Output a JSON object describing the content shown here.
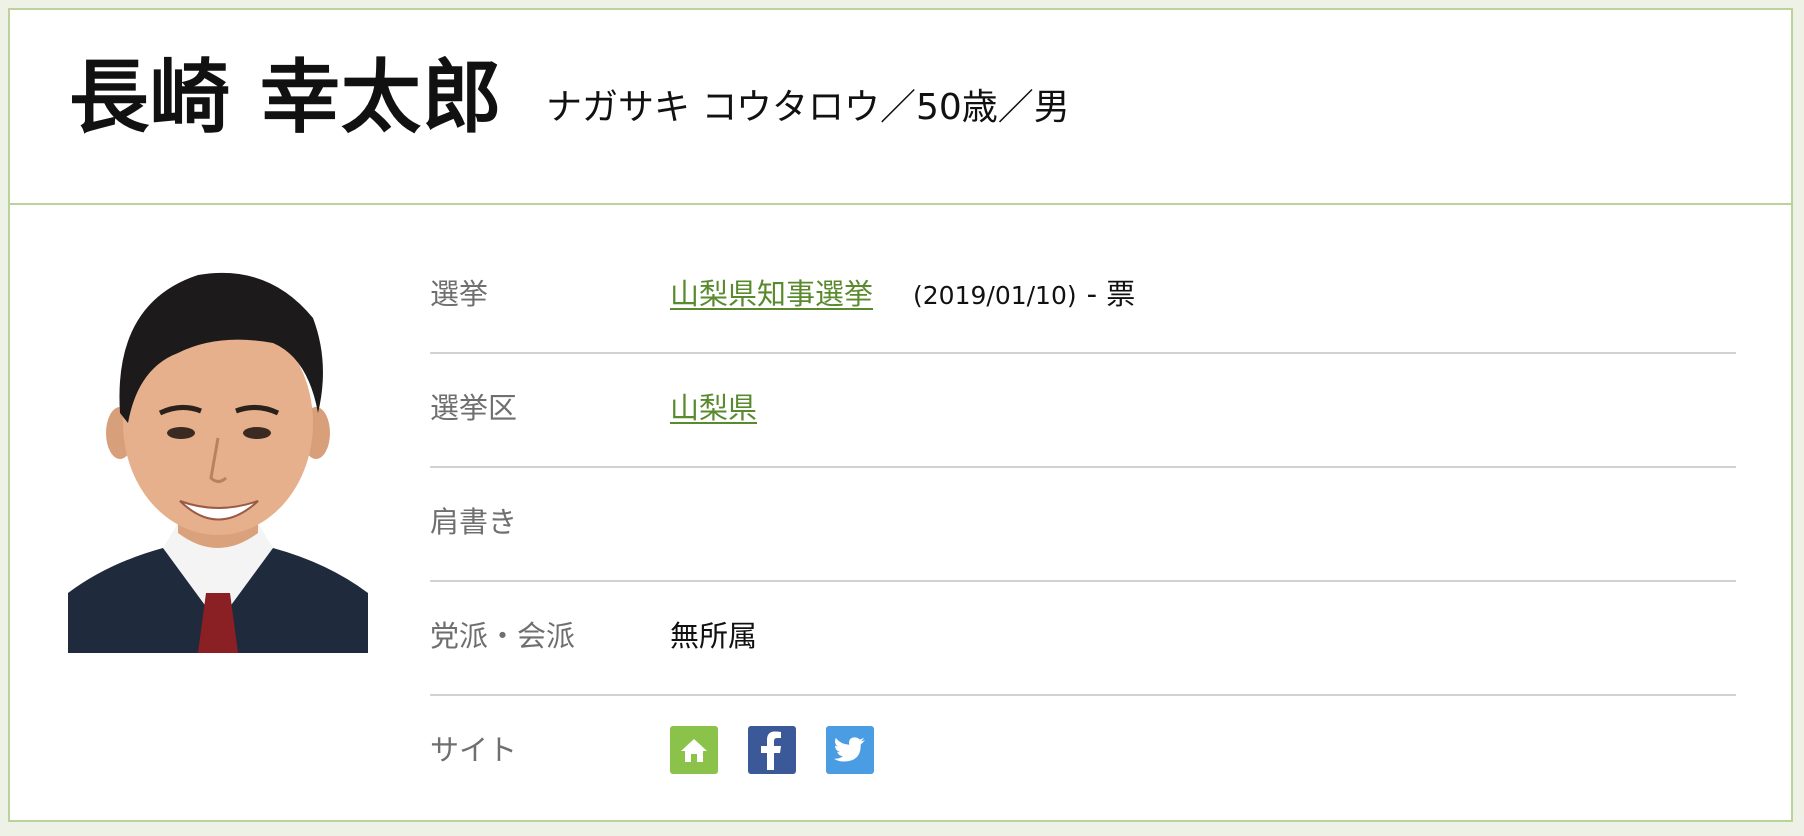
{
  "profile": {
    "name": "長崎 幸太郎",
    "subinfo": "ナガサキ コウタロウ／50歳／男"
  },
  "rows": {
    "election": {
      "label": "選挙",
      "link": "山梨県知事選挙",
      "date": "(2019/01/10)",
      "votes": "- 票"
    },
    "district": {
      "label": "選挙区",
      "link": "山梨県"
    },
    "title": {
      "label": "肩書き",
      "value": ""
    },
    "party": {
      "label": "党派・会派",
      "value": "無所属"
    },
    "site": {
      "label": "サイト",
      "icons": [
        "home-icon",
        "facebook-icon",
        "twitter-icon"
      ]
    }
  },
  "colors": {
    "border": "#b9d39a",
    "link": "#5a8a2e",
    "home": "#8bc34a",
    "facebook": "#3b5998",
    "twitter": "#4a9de2"
  }
}
